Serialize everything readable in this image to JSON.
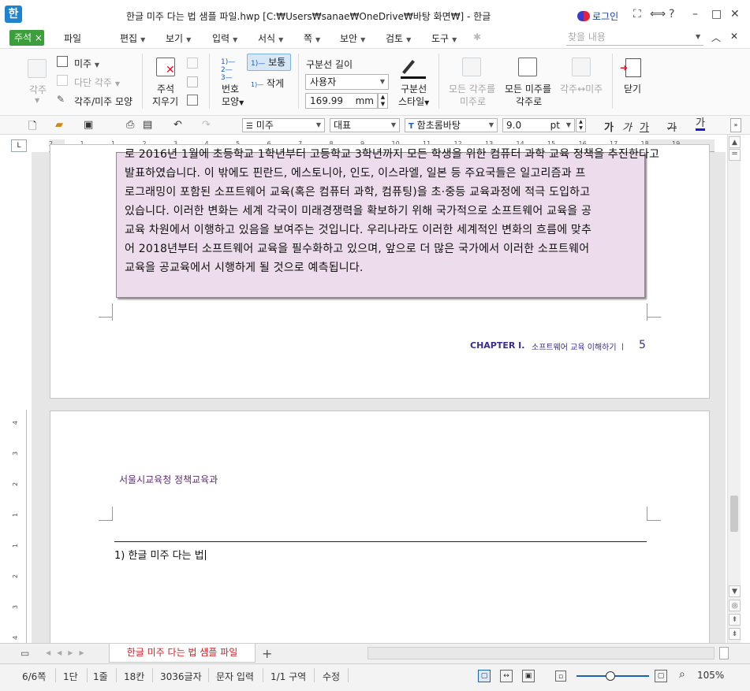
{
  "titlebar": {
    "app_logo": "한",
    "title": "한글 미주 다는 법 샘플 파일.hwp [C:₩Users₩sanae₩OneDrive₩바탕 화면₩] - 한글",
    "login": "로그인",
    "help": "?"
  },
  "menubar": {
    "memo_tab": "주석 ×",
    "items": [
      "파일",
      "편집",
      "보기",
      "입력",
      "서식",
      "쪽",
      "보안",
      "검토",
      "도구"
    ],
    "search_placeholder": "찾을 내용"
  },
  "ribbon": {
    "footnote": "각주",
    "endnote": "미주",
    "multi_footnote": "다단 각주",
    "footnote_shape": "각주/미주 모양",
    "delete_note_1": "주석",
    "delete_note_2": "지우기",
    "number_1": "번호",
    "number_2": "모양",
    "size_normal": "보통",
    "size_small": "작게",
    "sep_length_label": "구분선 길이",
    "sep_length_select": "사용자",
    "sep_length_value": "169.99",
    "sep_length_unit": "mm",
    "sep_style_1": "구분선",
    "sep_style_2": "스타일",
    "all_foot_to_end_1": "모든 각주를",
    "all_foot_to_end_2": "미주로",
    "all_end_to_foot_1": "모든 미주를",
    "all_end_to_foot_2": "각주로",
    "swap": "각주↔미주",
    "close": "닫기"
  },
  "toolbar": {
    "style": "미주",
    "lang": "대표",
    "font": "함초롬바탕",
    "size": "9.0",
    "size_unit": "pt",
    "bold": "가",
    "italic": "가",
    "underline": "가",
    "strike": "가",
    "color": "가"
  },
  "ruler": {
    "corner": "L",
    "ticks": [
      "2",
      "1",
      "1",
      "2",
      "3",
      "4",
      "5",
      "6",
      "7",
      "8",
      "9",
      "10",
      "11",
      "12",
      "13",
      "14",
      "15",
      "16",
      "17",
      "18",
      "19"
    ],
    "vticks": [
      "4",
      "3",
      "2",
      "1",
      "1",
      "2",
      "3",
      "4"
    ]
  },
  "document": {
    "memo_lines": [
      "로 2016년 1월에 초등학교 1학년부터 고등학교 3학년까지 모든 학생을 위한 컴퓨터 과학 교육 정책을 추진한다고",
      "발표하였습니다. 이 밖에도 핀란드, 에스토니아, 인도, 이스라엘, 일본 등 주요국들은 일고리즘과 프",
      "로그래밍이 포함된 소프트웨어 교육(혹은 컴퓨터 과학, 컴퓨팅)을 초·중등 교육과정에 적극 도입하고",
      "있습니다. 이러한 변화는 세계 각국이 미래경쟁력을 확보하기 위해 국가적으로 소프트웨어 교육을 공",
      "교육 차원에서 이행하고 있음을 보여주는 것입니다. 우리나라도 이러한 세계적인 변화의 흐름에 맞추",
      "어 2018년부터 소프트웨어 교육을 필수화하고 있으며, 앞으로 더 많은 국가에서 이러한 소프트웨어",
      "교육을 공교육에서 시행하게 될 것으로 예측됩니다."
    ],
    "chapter": "CHAPTER I.",
    "chapter_sub": "소프트웨어 교육 이해하기 ㅣ",
    "page_number": "5",
    "header_text": "서울시교육청 정책교육과",
    "footnote_text": "1) 한글 미주 다는 법"
  },
  "tabs": {
    "doc_tab": "한글 미주 다는 법 샘플 파일",
    "add": "+"
  },
  "status": {
    "page": "6/6쪽",
    "column": "1단",
    "line": "1줄",
    "col": "18칸",
    "chars": "3036글자",
    "mode": "문자 입력",
    "section": "1/1 구역",
    "edit": "수정",
    "zoom": "105%"
  },
  "colors": {
    "accent": "#1d84d3",
    "memo_tab": "#3c9f3c",
    "memo_bg": "#ecdcec",
    "chapter": "#3b2c8c",
    "doc_tab_text": "#d2232a"
  }
}
